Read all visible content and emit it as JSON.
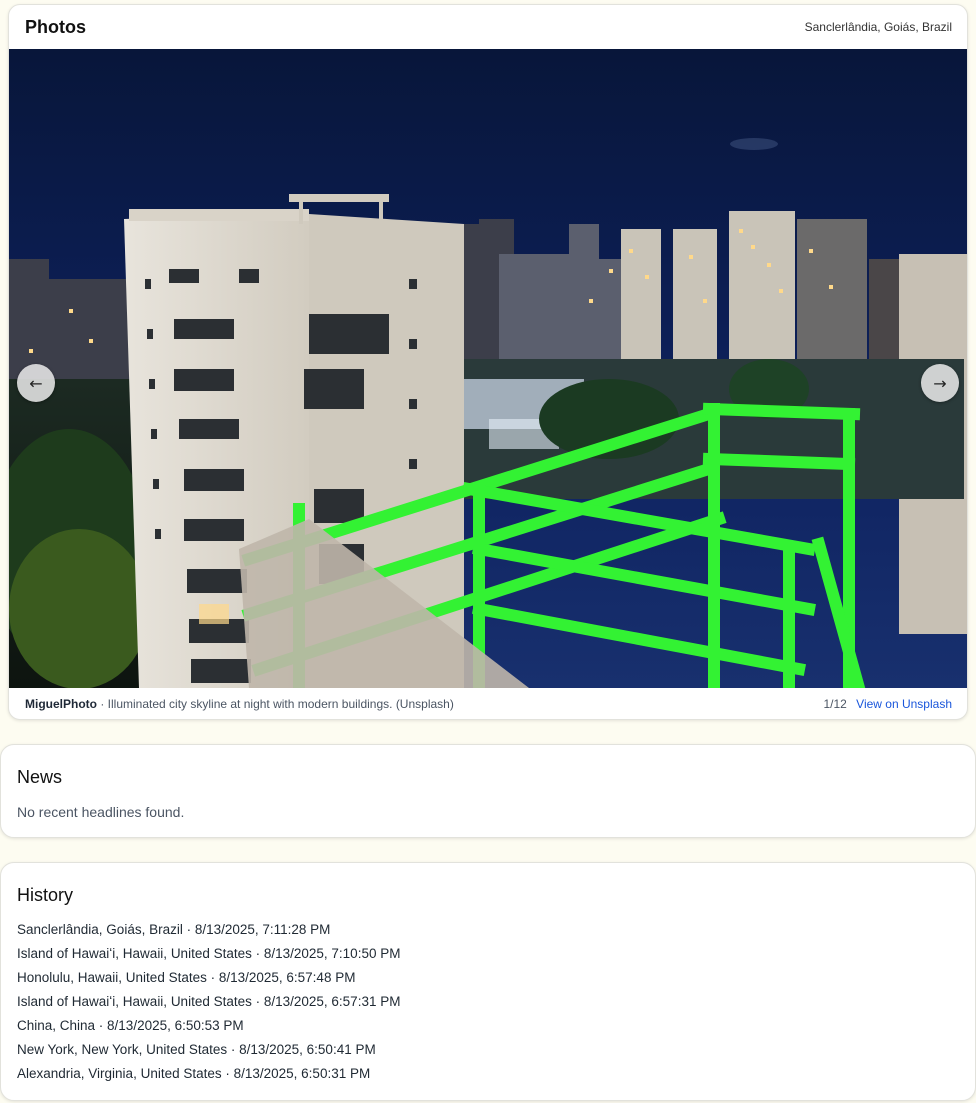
{
  "photos": {
    "title": "Photos",
    "location": "Sanclerlândia, Goiás, Brazil",
    "prev_icon": "←",
    "next_icon": "→",
    "author": "MiguelPhoto",
    "separator": " · ",
    "description": "Illuminated city skyline at night with modern buildings. (Unsplash)",
    "counter": "1/12",
    "link_label": "View on Unsplash"
  },
  "news": {
    "title": "News",
    "empty_message": "No recent headlines found."
  },
  "history": {
    "title": "History",
    "items": [
      "Sanclerlândia, Goiás, Brazil · 8/13/2025, 7:11:28 PM",
      "Island of Hawaiʻi, Hawaii, United States · 8/13/2025, 7:10:50 PM",
      "Honolulu, Hawaii, United States · 8/13/2025, 6:57:48 PM",
      "Island of Hawaiʻi, Hawaii, United States · 8/13/2025, 6:57:31 PM",
      "China, China · 8/13/2025, 6:50:53 PM",
      "New York, New York, United States · 8/13/2025, 6:50:41 PM",
      "Alexandria, Virginia, United States · 8/13/2025, 6:50:31 PM"
    ]
  },
  "colors": {
    "page_background": "#fdfcf1",
    "link": "#1a56db",
    "railing_green": "#2ee82e",
    "sky": "#0b1a44"
  }
}
